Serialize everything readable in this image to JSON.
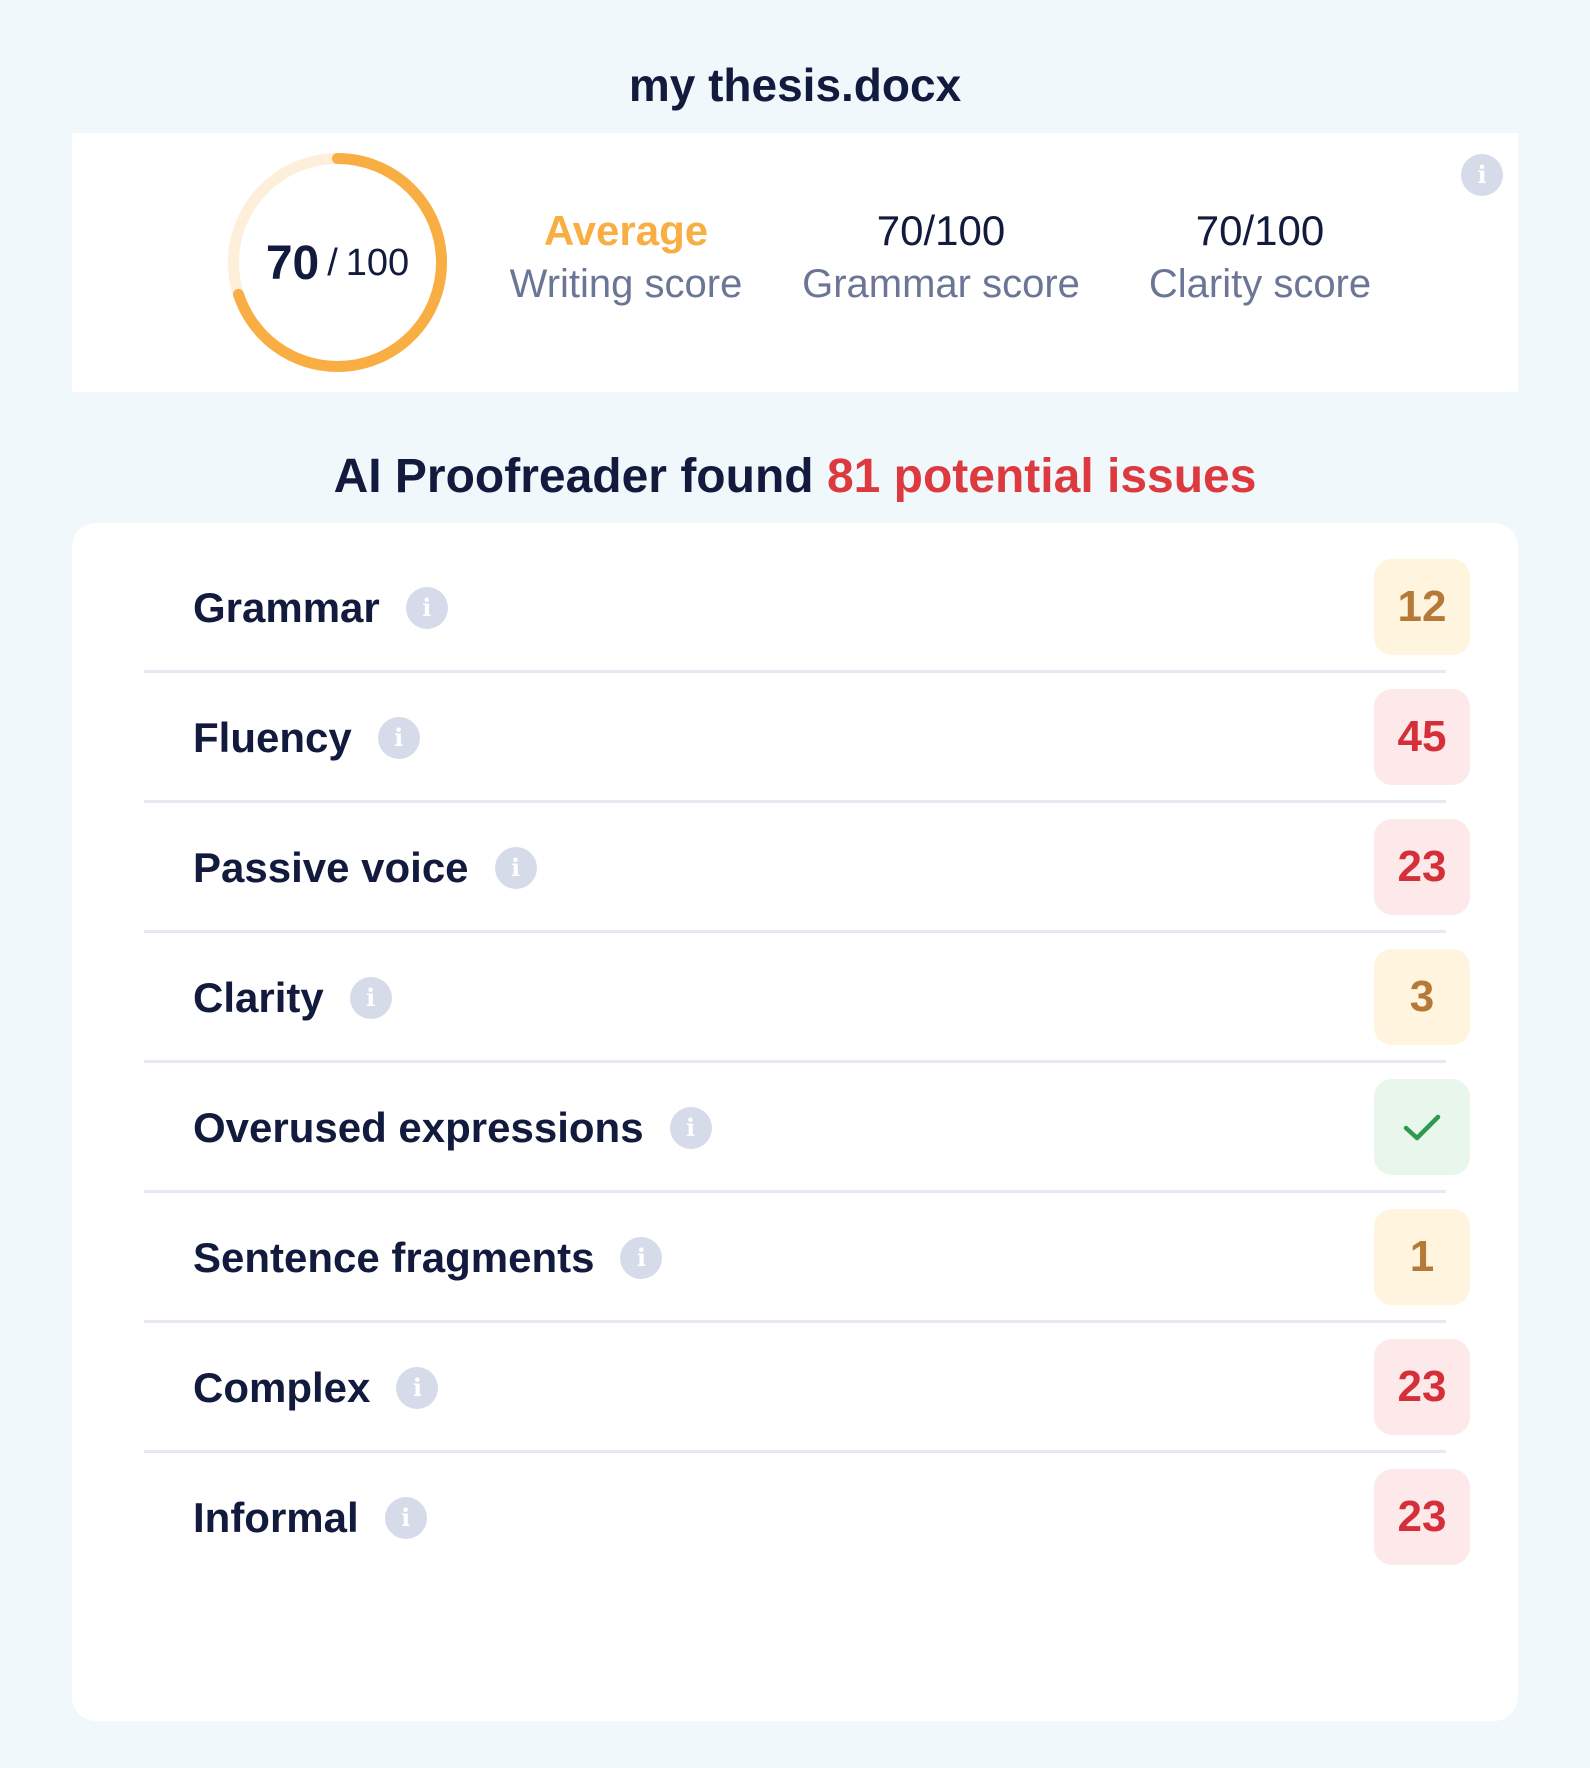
{
  "document": {
    "title": "my thesis.docx"
  },
  "score": {
    "value": "70",
    "separator": "/",
    "max": "100",
    "fraction": 0.7,
    "ring_color": "#f8ae42",
    "track_color": "#fdefd9",
    "writing": {
      "value": "Average",
      "label": "Writing score"
    },
    "grammar": {
      "value": "70/100",
      "label": "Grammar score"
    },
    "clarity": {
      "value": "70/100",
      "label": "Clarity score"
    },
    "info_icon": "info-icon"
  },
  "summary": {
    "prefix": "AI Proofreader found",
    "count_text": "81 potential issues",
    "highlight_color": "#dd3a3f"
  },
  "issues": [
    {
      "label": "Grammar",
      "count": "12",
      "severity": "warn"
    },
    {
      "label": "Fluency",
      "count": "45",
      "severity": "err"
    },
    {
      "label": "Passive voice",
      "count": "23",
      "severity": "err"
    },
    {
      "label": "Clarity",
      "count": "3",
      "severity": "warn"
    },
    {
      "label": "Overused expressions",
      "count": "",
      "severity": "ok",
      "icon": "check-icon"
    },
    {
      "label": "Sentence fragments",
      "count": "1",
      "severity": "warn"
    },
    {
      "label": "Complex",
      "count": "23",
      "severity": "err"
    },
    {
      "label": "Informal",
      "count": "23",
      "severity": "err"
    }
  ],
  "info_glyph": "i"
}
